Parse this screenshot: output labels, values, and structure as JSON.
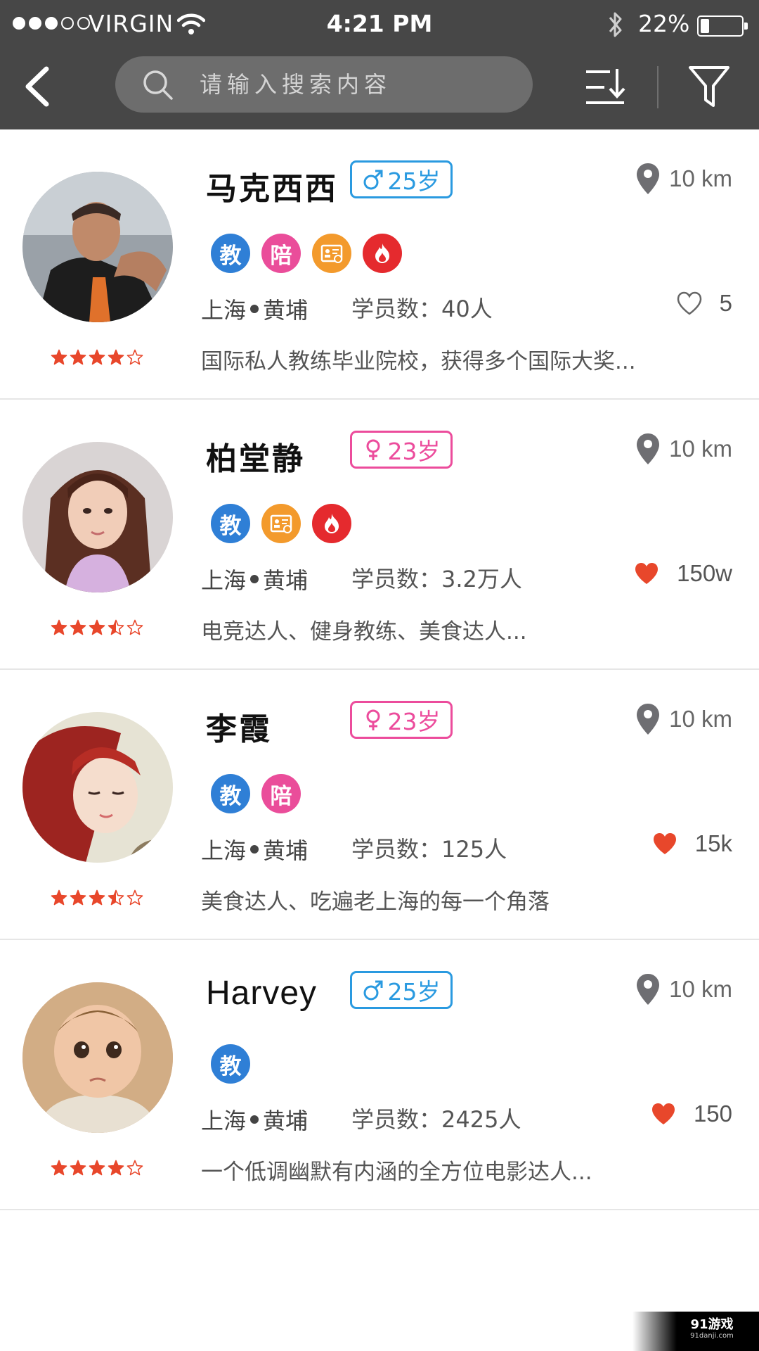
{
  "status_bar": {
    "carrier": "VIRGIN",
    "time": "4:21 PM",
    "battery": "22%",
    "signal_bars_filled": 3,
    "signal_bars_total": 5,
    "battery_level": 0.22
  },
  "nav": {
    "search_placeholder": "请输入搜索内容",
    "back_icon": "back-arrow-icon",
    "sort_icon": "sort-descending-icon",
    "filter_icon": "filter-funnel-icon"
  },
  "coaches": [
    {
      "name": "马克西西",
      "gender": "male",
      "gender_symbol": "♂",
      "age": "25岁",
      "distance": "10 km",
      "tags": [
        "教",
        "陪",
        "cert",
        "hot"
      ],
      "city": "上海",
      "district": "黄埔",
      "students": "学员数：40人",
      "liked": false,
      "likes": "5",
      "rating": 4,
      "description": "国际私人教练毕业院校，获得多个国际大奖..."
    },
    {
      "name": "柏堂静",
      "gender": "female",
      "gender_symbol": "♀",
      "age": "23岁",
      "distance": "10 km",
      "tags": [
        "教",
        "cert",
        "hot"
      ],
      "city": "上海",
      "district": "黄埔",
      "students": "学员数：3.2万人",
      "liked": true,
      "likes": "150w",
      "rating": 3.5,
      "description": "电竞达人、健身教练、美食达人..."
    },
    {
      "name": "李霞",
      "gender": "female",
      "gender_symbol": "♀",
      "age": "23岁",
      "distance": "10 km",
      "tags": [
        "教",
        "陪"
      ],
      "city": "上海",
      "district": "黄埔",
      "students": "学员数：125人",
      "liked": true,
      "likes": "15k",
      "rating": 3.5,
      "description": "美食达人、吃遍老上海的每一个角落"
    },
    {
      "name": "Harvey",
      "gender": "male",
      "gender_symbol": "♂",
      "age": "25岁",
      "distance": "10 km",
      "tags": [
        "教"
      ],
      "city": "上海",
      "district": "黄埔",
      "students": "学员数：2425人",
      "liked": true,
      "likes": "150",
      "rating": 4,
      "description": "一个低调幽默有内涵的全方位电影达人..."
    }
  ],
  "colors": {
    "nav_bg": "#474747",
    "male": "#2a9ae0",
    "female": "#ec4c9c",
    "star": "#e8472b",
    "heart": "#e8472b",
    "tag_teach": "#2f7fd6",
    "tag_accompany": "#ea4d9a",
    "tag_cert": "#f39a2c",
    "tag_hot": "#e52a2e"
  },
  "watermark": {
    "logo": "91游戏",
    "site": "91danji.com"
  }
}
